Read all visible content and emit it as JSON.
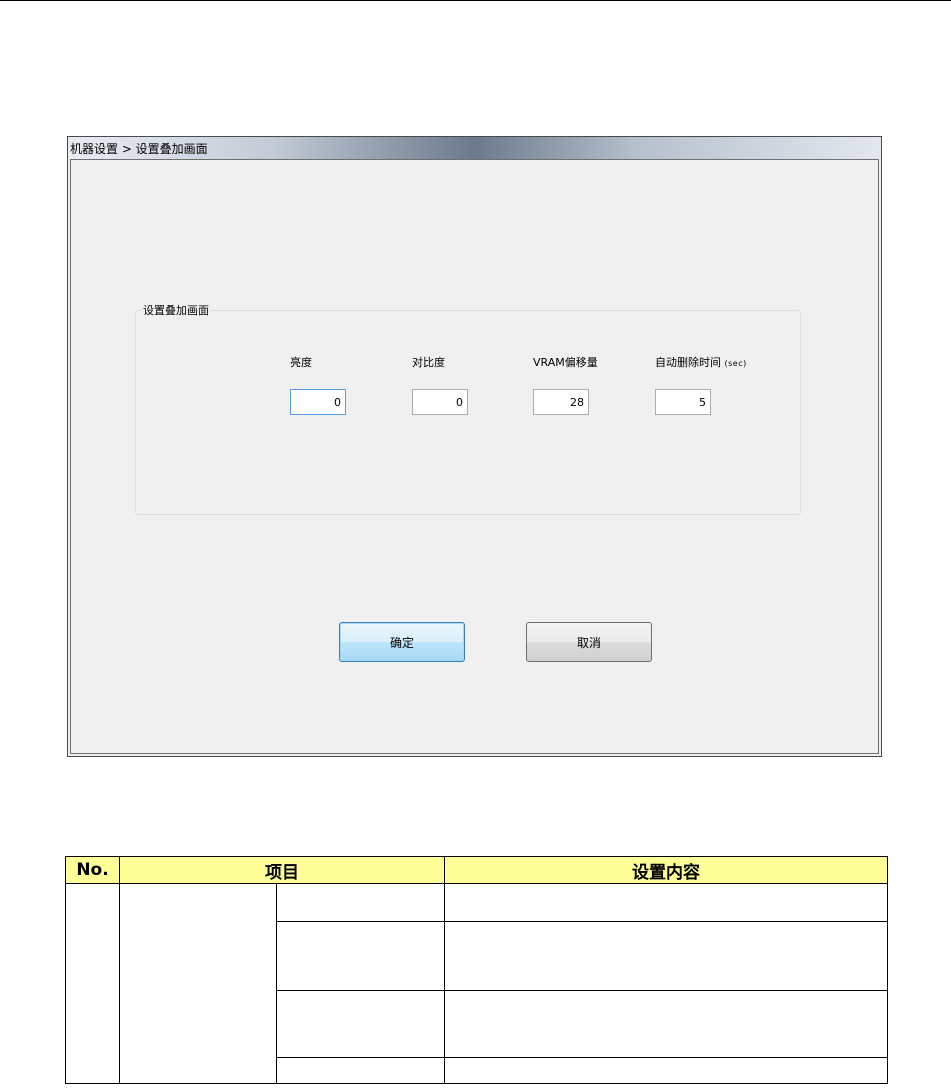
{
  "window": {
    "title": "机器设置 > 设置叠加画面"
  },
  "group": {
    "legend": "设置叠加画面",
    "fields": [
      {
        "label": "亮度",
        "unit": "",
        "value": "0",
        "focused": true
      },
      {
        "label": "对比度",
        "unit": "",
        "value": "0",
        "focused": false
      },
      {
        "label": "VRAM偏移量",
        "unit": "",
        "value": "28",
        "focused": false
      },
      {
        "label": "自动删除时间",
        "unit": "(sec)",
        "value": "5",
        "focused": false
      }
    ]
  },
  "buttons": {
    "ok_label": "确定",
    "cancel_label": "取消"
  },
  "table": {
    "headers": [
      "No.",
      "项目",
      "设置内容"
    ],
    "rows": [
      {
        "no": "",
        "item": "",
        "sub_item": "",
        "content": ""
      },
      {
        "sub_item": "",
        "content": ""
      },
      {
        "sub_item": "",
        "content": ""
      },
      {
        "sub_item": "",
        "content": ""
      }
    ]
  }
}
